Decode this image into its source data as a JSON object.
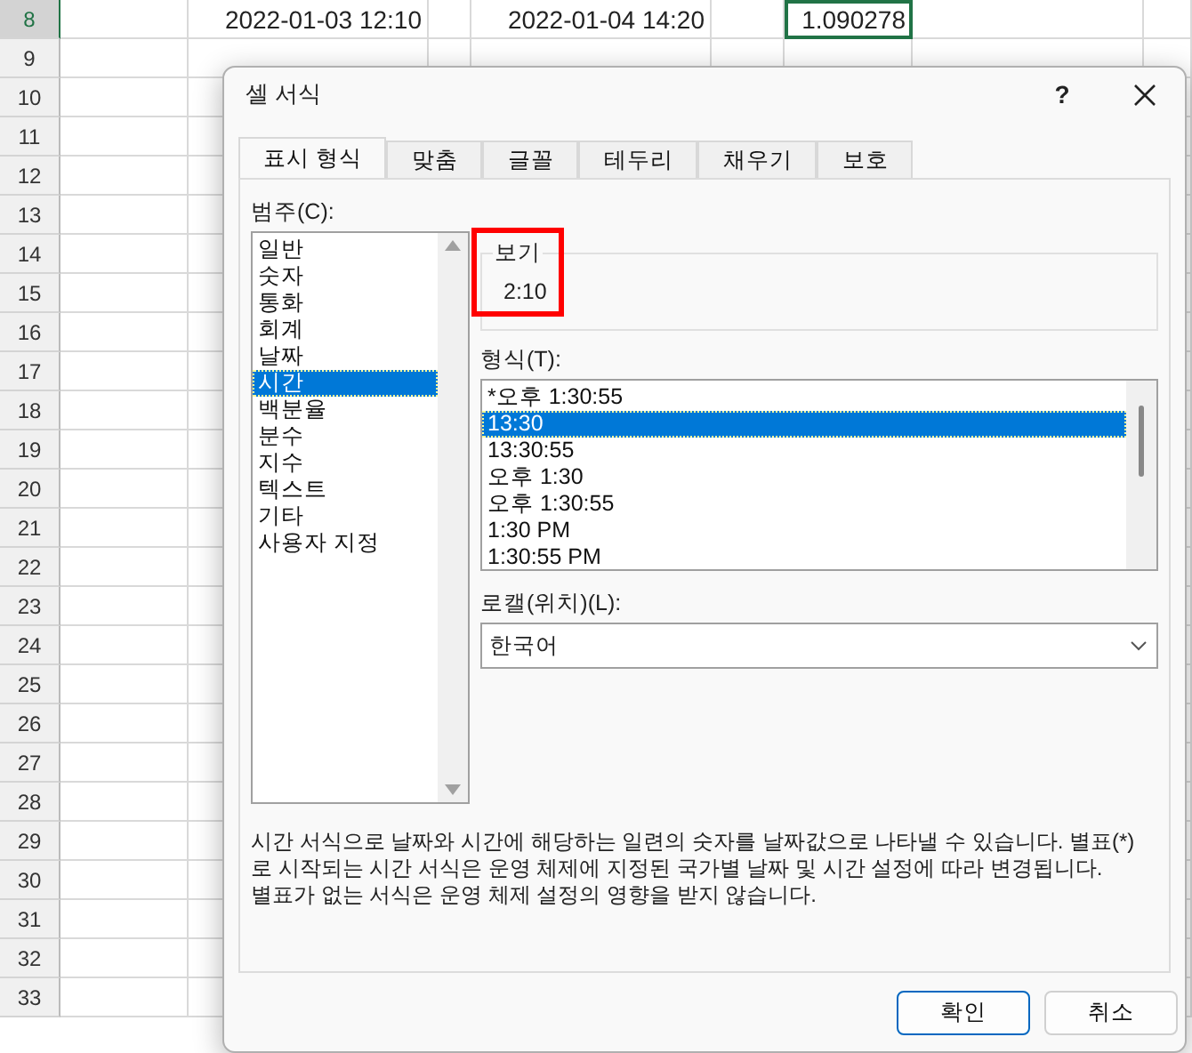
{
  "sheet": {
    "rows": [
      {
        "header": "8",
        "selected": true,
        "cells": [
          {
            "text": "2022-01-03 12:10",
            "selected": false
          },
          {
            "text": "2022-01-04 14:20",
            "selected": false
          },
          {
            "text": "1.090278",
            "selected": true
          }
        ]
      },
      {
        "header": "9",
        "selected": false
      },
      {
        "header": "10",
        "selected": false
      },
      {
        "header": "11",
        "selected": false
      },
      {
        "header": "12",
        "selected": false
      },
      {
        "header": "13",
        "selected": false
      },
      {
        "header": "14",
        "selected": false
      },
      {
        "header": "15",
        "selected": false
      },
      {
        "header": "16",
        "selected": false
      },
      {
        "header": "17",
        "selected": false
      },
      {
        "header": "18",
        "selected": false
      },
      {
        "header": "19",
        "selected": false
      },
      {
        "header": "20",
        "selected": false
      },
      {
        "header": "21",
        "selected": false
      },
      {
        "header": "22",
        "selected": false
      },
      {
        "header": "23",
        "selected": false
      },
      {
        "header": "24",
        "selected": false
      },
      {
        "header": "25",
        "selected": false
      },
      {
        "header": "26",
        "selected": false
      },
      {
        "header": "27",
        "selected": false
      },
      {
        "header": "28",
        "selected": false
      },
      {
        "header": "29",
        "selected": false
      },
      {
        "header": "30",
        "selected": false
      },
      {
        "header": "31",
        "selected": false
      },
      {
        "header": "32",
        "selected": false
      },
      {
        "header": "33",
        "selected": false
      }
    ]
  },
  "dialog": {
    "title": "셀 서식",
    "help": "?",
    "tabs": [
      {
        "label": "표시 형식",
        "selected": true
      },
      {
        "label": "맞춤",
        "selected": false
      },
      {
        "label": "글꼴",
        "selected": false
      },
      {
        "label": "테두리",
        "selected": false
      },
      {
        "label": "채우기",
        "selected": false
      },
      {
        "label": "보호",
        "selected": false
      }
    ],
    "category_label": "범주(C):",
    "categories": [
      {
        "label": "일반",
        "selected": false
      },
      {
        "label": "숫자",
        "selected": false
      },
      {
        "label": "통화",
        "selected": false
      },
      {
        "label": "회계",
        "selected": false
      },
      {
        "label": "날짜",
        "selected": false
      },
      {
        "label": "시간",
        "selected": true
      },
      {
        "label": "백분율",
        "selected": false
      },
      {
        "label": "분수",
        "selected": false
      },
      {
        "label": "지수",
        "selected": false
      },
      {
        "label": "텍스트",
        "selected": false
      },
      {
        "label": "기타",
        "selected": false
      },
      {
        "label": "사용자 지정",
        "selected": false
      }
    ],
    "sample": {
      "label": "보기",
      "value": "2:10",
      "highlighted": true
    },
    "format_label": "형식(T):",
    "formats": [
      {
        "label": "*오후 1:30:55",
        "selected": false
      },
      {
        "label": "13:30",
        "selected": true
      },
      {
        "label": "13:30:55",
        "selected": false
      },
      {
        "label": "오후 1:30",
        "selected": false
      },
      {
        "label": "오후 1:30:55",
        "selected": false
      },
      {
        "label": "1:30 PM",
        "selected": false
      },
      {
        "label": "1:30:55 PM",
        "selected": false
      }
    ],
    "locale_label": "로캘(위치)(L):",
    "locale": "한국어",
    "description": [
      "시간 서식으로 날짜와 시간에 해당하는 일련의 숫자를 날짜값으로 나타낼 수 있습니다. 별표(*)",
      "로 시작되는 시간 서식은 운영 체제에 지정된 국가별 날짜 및 시간 설정에 따라 변경됩니다.",
      "별표가 없는 서식은 운영 체제 설정의 영향을 받지 않습니다."
    ],
    "buttons": [
      {
        "label": "확인",
        "kind": "primary"
      },
      {
        "label": "취소",
        "kind": "secondary"
      }
    ]
  }
}
